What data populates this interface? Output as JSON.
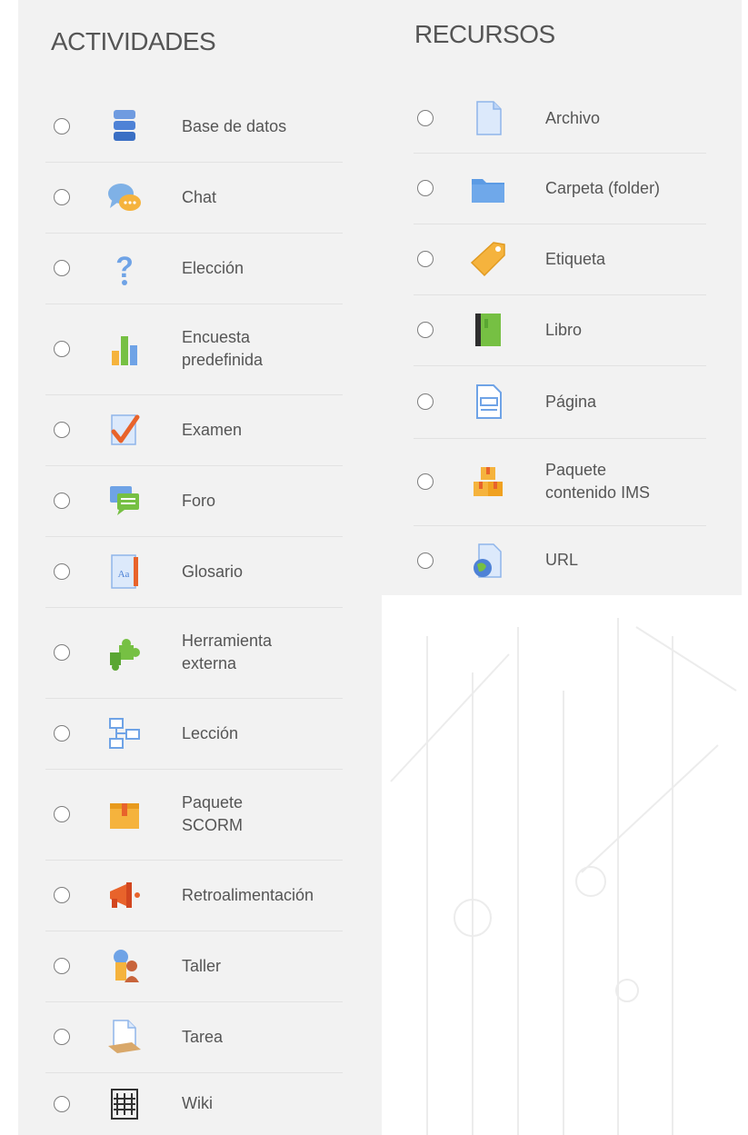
{
  "activities": {
    "title": "ACTIVIDADES",
    "items": [
      {
        "label": "Base de datos",
        "icon": "database-icon"
      },
      {
        "label": "Chat",
        "icon": "chat-icon"
      },
      {
        "label": "Elección",
        "icon": "question-icon"
      },
      {
        "label": "Encuesta\npredefinida",
        "icon": "survey-chart-icon"
      },
      {
        "label": "Examen",
        "icon": "quiz-check-icon"
      },
      {
        "label": "Foro",
        "icon": "forum-icon"
      },
      {
        "label": "Glosario",
        "icon": "glossary-icon"
      },
      {
        "label": "Herramienta\nexterna",
        "icon": "puzzle-icon"
      },
      {
        "label": "Lección",
        "icon": "lesson-flow-icon"
      },
      {
        "label": "Paquete\nSCORM",
        "icon": "scorm-package-icon"
      },
      {
        "label": "Retroalimentación",
        "icon": "megaphone-icon"
      },
      {
        "label": "Taller",
        "icon": "workshop-icon"
      },
      {
        "label": "Tarea",
        "icon": "assignment-icon"
      },
      {
        "label": "Wiki",
        "icon": "wiki-icon"
      }
    ]
  },
  "resources": {
    "title": "RECURSOS",
    "items": [
      {
        "label": "Archivo",
        "icon": "file-icon"
      },
      {
        "label": "Carpeta (folder)",
        "icon": "folder-icon"
      },
      {
        "label": "Etiqueta",
        "icon": "tag-icon"
      },
      {
        "label": "Libro",
        "icon": "book-icon"
      },
      {
        "label": "Página",
        "icon": "page-icon"
      },
      {
        "label": "Paquete\ncontenido IMS",
        "icon": "ims-package-icon"
      },
      {
        "label": "URL",
        "icon": "url-globe-icon"
      }
    ]
  },
  "colors": {
    "panel_bg": "#f2f2f2",
    "text": "#555555",
    "separator": "#e2e2e2",
    "radio_border": "#7d7d7d"
  }
}
